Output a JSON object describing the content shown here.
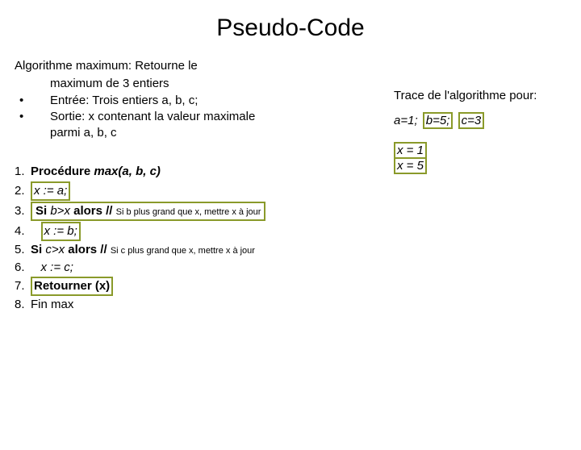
{
  "title": "Pseudo-Code",
  "desc": {
    "line1": "Algorithme maximum: Retourne le",
    "line2": "maximum de 3 entiers",
    "bullet_dot": "•",
    "entry": "Entrée: Trois entiers a, b, c;",
    "sortie1": "Sortie: x contenant la valeur maximale",
    "sortie2": "parmi a, b, c"
  },
  "steps": {
    "s1": {
      "n": "1.",
      "lead": "Procédure ",
      "proc": "max(a, b, c)"
    },
    "s2": {
      "n": "2.",
      "body": "x := a;"
    },
    "s3": {
      "n": "3.",
      "pre": "Si ",
      "cond": "b>x ",
      "alors": "alors // ",
      "comment": "Si b plus grand que x, mettre x à jour"
    },
    "s4": {
      "n": "4.",
      "body": "x := b;"
    },
    "s5": {
      "n": "5.",
      "pre": "Si ",
      "cond": "c>x ",
      "alors": "alors // ",
      "comment": "Si c plus grand que x, mettre x à jour"
    },
    "s6": {
      "n": "6.",
      "body": "x := c;"
    },
    "s7": {
      "n": "7.",
      "body": "Retourner (x)"
    },
    "s8": {
      "n": "8.",
      "body": "Fin max"
    }
  },
  "trace": {
    "title": "Trace de l'algorithme pour:",
    "a": "a=1;",
    "b": "b=5;",
    "c": "c=3",
    "x1": "x = 1",
    "x2": "x = 5"
  }
}
